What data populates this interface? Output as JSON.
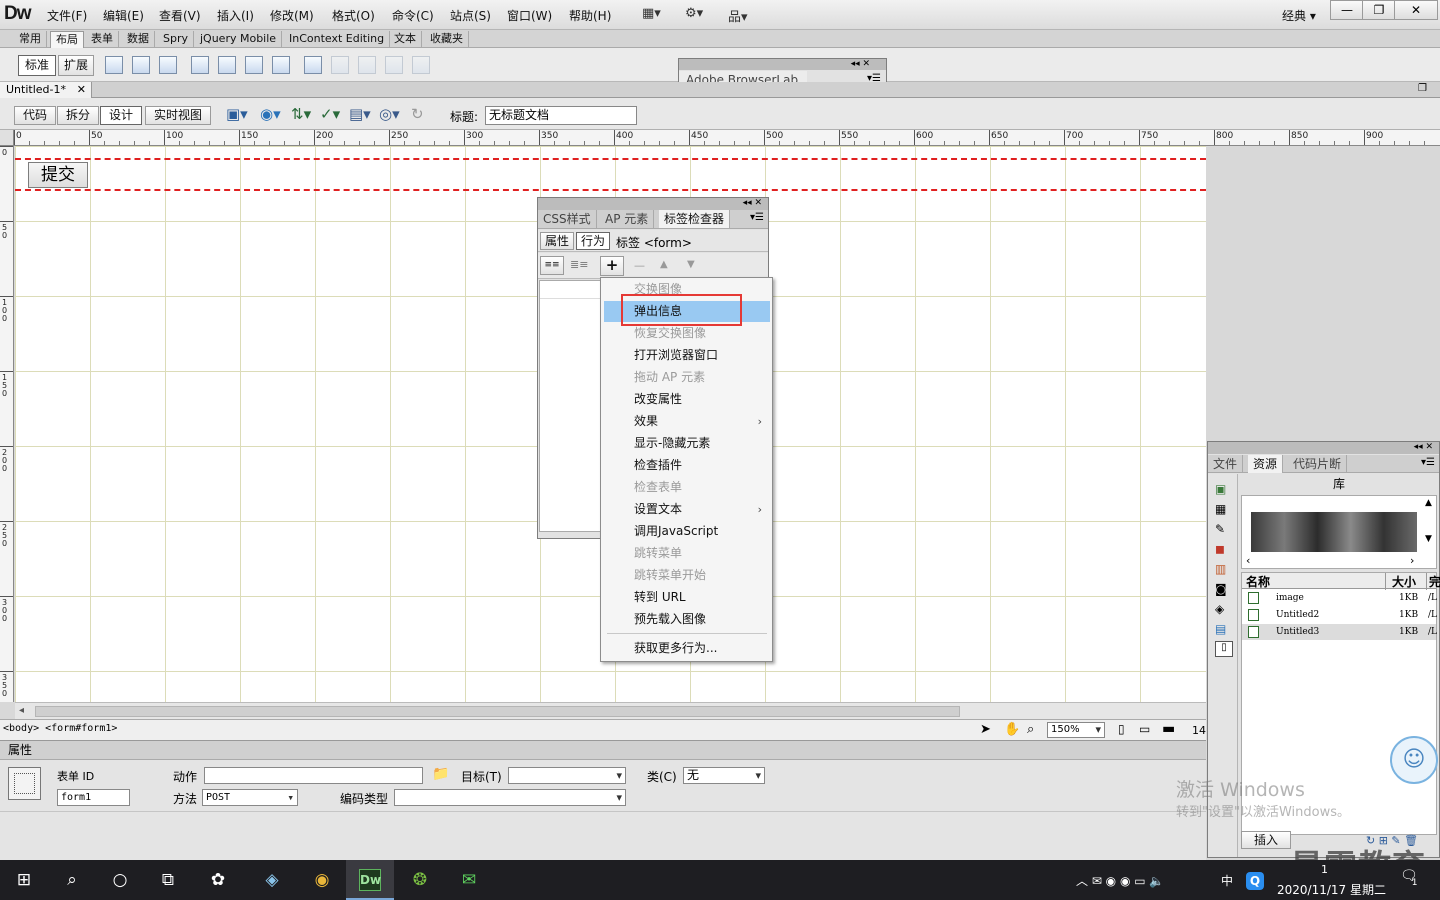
{
  "app": {
    "logo": "Dw",
    "workspace": "经典"
  },
  "menu": [
    "文件(F)",
    "编辑(E)",
    "查看(V)",
    "插入(I)",
    "修改(M)",
    "格式(O)",
    "命令(C)",
    "站点(S)",
    "窗口(W)",
    "帮助(H)"
  ],
  "window_controls": {
    "minimize": "—",
    "restore": "❐",
    "close": "✕"
  },
  "insert_tabs": [
    "常用",
    "布局",
    "表单",
    "数据",
    "Spry",
    "jQuery Mobile",
    "InContext Editing",
    "文本",
    "收藏夹"
  ],
  "layout_modes": {
    "standard": "标准",
    "expanded": "扩展"
  },
  "browserlab": {
    "title": "Adobe BrowserLab"
  },
  "document": {
    "tab": "Untitled-1*",
    "close": "✕",
    "view_buttons": [
      "代码",
      "拆分",
      "设计",
      "实时视图"
    ],
    "title_label": "标题:",
    "title_value": "无标题文档"
  },
  "ruler": {
    "marks": [
      "0",
      "50",
      "100",
      "150",
      "200",
      "250",
      "300",
      "350",
      "400",
      "450",
      "500",
      "550",
      "600",
      "650",
      "700",
      "750",
      "800",
      "850",
      "900"
    ]
  },
  "vruler": {
    "marks": [
      "0",
      "5\n0",
      "1\n0\n0",
      "1\n5\n0",
      "2\n0\n0",
      "2\n5\n0",
      "3\n0\n0",
      "3\n5\n0"
    ]
  },
  "canvas": {
    "submit_button": "提交"
  },
  "status": {
    "tags": "<body> <form#form1>",
    "zoom": "150%",
    "size": "14"
  },
  "properties": {
    "header": "属性",
    "form_id_label": "表单 ID",
    "form_id_value": "form1",
    "action_label": "动作",
    "action_value": "",
    "method_label": "方法",
    "method_value": "POST",
    "target_label": "目标(T)",
    "target_value": "",
    "enctype_label": "编码类型",
    "enctype_value": "",
    "class_label": "类(C)",
    "class_value": "无"
  },
  "tag_inspector": {
    "tabs": [
      "CSS样式",
      "AP 元素",
      "标签检查器"
    ],
    "subtabs": [
      "属性",
      "行为"
    ],
    "tag_label": "标签 <form>",
    "add": "+",
    "remove": "—",
    "up": "▲",
    "down": "▼"
  },
  "behaviors_menu": {
    "items": [
      {
        "label": "交换图像",
        "disabled": true
      },
      {
        "label": "弹出信息",
        "highlight": true
      },
      {
        "label": "恢复交换图像",
        "disabled": true
      },
      {
        "label": "打开浏览器窗口"
      },
      {
        "label": "拖动 AP 元素",
        "disabled": true
      },
      {
        "label": "改变属性"
      },
      {
        "label": "效果",
        "submenu": true
      },
      {
        "label": "显示-隐藏元素"
      },
      {
        "label": "检查插件"
      },
      {
        "label": "检查表单",
        "disabled": true
      },
      {
        "label": "设置文本",
        "submenu": true
      },
      {
        "label": "调用JavaScript"
      },
      {
        "label": "跳转菜单",
        "disabled": true
      },
      {
        "label": "跳转菜单开始",
        "disabled": true
      },
      {
        "label": "转到 URL"
      },
      {
        "label": "预先载入图像"
      }
    ],
    "more": "获取更多行为...",
    "submenu_glyph": "›"
  },
  "assets_panel": {
    "tabs": [
      "文件",
      "资源",
      "代码片断"
    ],
    "library_label": "库",
    "col_name": "名称",
    "col_size": "大小",
    "col_full": "完",
    "rows": [
      {
        "name": "image",
        "size": "1KB",
        "path": "/L"
      },
      {
        "name": "Untitled2",
        "size": "1KB",
        "path": "/L"
      },
      {
        "name": "Untitled3",
        "size": "1KB",
        "path": "/L"
      }
    ],
    "insert_button": "插入"
  },
  "watermark": {
    "activate_title": "激活 Windows",
    "activate_sub": "转到\"设置\"以激活Windows。",
    "brand": "最需教育"
  },
  "taskbar": {
    "apps": [
      "⊞",
      "⌕",
      "○",
      "⧉",
      "✿",
      "◈",
      "◉",
      "Dw",
      "❂",
      "✉"
    ],
    "ime": "中",
    "date": "2020/11/17 星期二",
    "time": "1",
    "tray_icons": "︿ ✉ ◉ ◉ ▭ 🔈",
    "notify": "1"
  },
  "colors": {
    "highlight_box": "#e53935",
    "menu_highlight": "#99c9f2",
    "guide_red": "#e02020"
  }
}
